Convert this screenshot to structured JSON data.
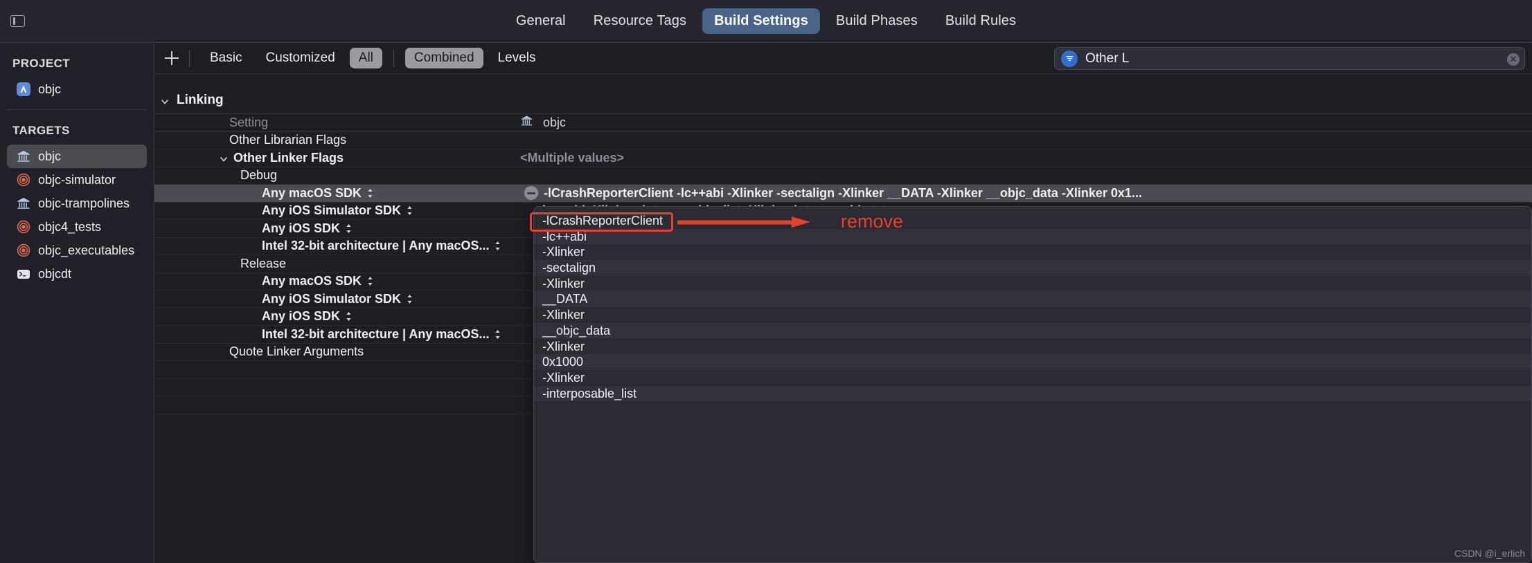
{
  "toolbar": {
    "sidebar_toggle_icon": "sidebar-toggle-icon",
    "tabs": [
      {
        "label": "General",
        "active": false
      },
      {
        "label": "Resource Tags",
        "active": false
      },
      {
        "label": "Build Settings",
        "active": true
      },
      {
        "label": "Build Phases",
        "active": false
      },
      {
        "label": "Build Rules",
        "active": false
      }
    ]
  },
  "sidebar": {
    "project_label": "PROJECT",
    "project_items": [
      {
        "label": "objc",
        "icon": "app-icon",
        "selected": false
      }
    ],
    "targets_label": "TARGETS",
    "target_items": [
      {
        "label": "objc",
        "icon": "library-icon",
        "selected": true
      },
      {
        "label": "objc-simulator",
        "icon": "bullseye-icon",
        "selected": false
      },
      {
        "label": "objc-trampolines",
        "icon": "library-icon",
        "selected": false
      },
      {
        "label": "objc4_tests",
        "icon": "bullseye-icon",
        "selected": false
      },
      {
        "label": "objc_executables",
        "icon": "bullseye-icon",
        "selected": false
      },
      {
        "label": "objcdt",
        "icon": "terminal-icon",
        "selected": false
      }
    ]
  },
  "filterbar": {
    "add_label": "+",
    "segments": [
      {
        "label": "Basic",
        "on": false
      },
      {
        "label": "Customized",
        "on": false
      },
      {
        "label": "All",
        "on": true
      },
      {
        "label": "Combined",
        "on": true
      },
      {
        "label": "Levels",
        "on": false
      }
    ],
    "search": {
      "token": "Other L",
      "badge_icon": "filter-badge-icon",
      "clear_icon": "clear-icon",
      "accent": "#2f6fd0"
    }
  },
  "settings": {
    "group_title": "Linking",
    "columns": {
      "setting": "Setting",
      "target": "objc",
      "target_icon": "library-icon"
    },
    "rows": [
      {
        "name": "Other Librarian Flags",
        "value": "",
        "indent": 0,
        "bold": false,
        "expandable": false,
        "selected": false
      },
      {
        "name": "Other Linker Flags",
        "value": "<Multiple values>",
        "indent": 0,
        "bold": true,
        "expandable": true,
        "selected": false,
        "value_muted": true
      },
      {
        "name": "Debug",
        "value": "",
        "indent": 1,
        "bold": false,
        "expandable": false,
        "selected": false
      },
      {
        "name": "Any macOS SDK",
        "value": "-lCrashReporterClient -lc++abi -Xlinker -sectalign -Xlinker __DATA -Xlinker __objc_data -Xlinker 0x1...",
        "indent": 2,
        "bold": true,
        "expandable": false,
        "selected": true,
        "stepper": true,
        "minus": true
      },
      {
        "name": "Any iOS Simulator SDK",
        "value": "-lc++abi -Xlinker -interposable_list -Xlinker interposable.txt",
        "indent": 2,
        "bold": true,
        "expandable": false,
        "selected": false,
        "stepper": true
      },
      {
        "name": "Any iOS SDK",
        "value": "",
        "indent": 2,
        "bold": true,
        "expandable": false,
        "selected": false,
        "stepper": true
      },
      {
        "name": "Intel 32-bit architecture | Any macOS...",
        "value": "",
        "indent": 2,
        "bold": true,
        "expandable": false,
        "selected": false,
        "stepper": true
      },
      {
        "name": "Release",
        "value": "",
        "indent": 1,
        "bold": false,
        "expandable": false,
        "selected": false
      },
      {
        "name": "Any macOS SDK",
        "value": "",
        "indent": 2,
        "bold": true,
        "expandable": false,
        "selected": false,
        "stepper": true
      },
      {
        "name": "Any iOS Simulator SDK",
        "value": "",
        "indent": 2,
        "bold": true,
        "expandable": false,
        "selected": false,
        "stepper": true
      },
      {
        "name": "Any iOS SDK",
        "value": "",
        "indent": 2,
        "bold": true,
        "expandable": false,
        "selected": false,
        "stepper": true
      },
      {
        "name": "Intel 32-bit architecture | Any macOS...",
        "value": "",
        "indent": 2,
        "bold": true,
        "expandable": false,
        "selected": false,
        "stepper": true
      },
      {
        "name": "Quote Linker Arguments",
        "value": "",
        "indent": 0,
        "bold": false,
        "expandable": false,
        "selected": false
      }
    ]
  },
  "popup": {
    "items": [
      "-lCrashReporterClient",
      "-lc++abi",
      "-Xlinker",
      "-sectalign",
      "-Xlinker",
      "__DATA",
      "-Xlinker",
      "__objc_data",
      "-Xlinker",
      "0x1000",
      "-Xlinker",
      "-interposable_list"
    ]
  },
  "annotations": {
    "remove_label": "remove",
    "accent": "#e8402a",
    "watermark": "CSDN @i_erlich"
  }
}
